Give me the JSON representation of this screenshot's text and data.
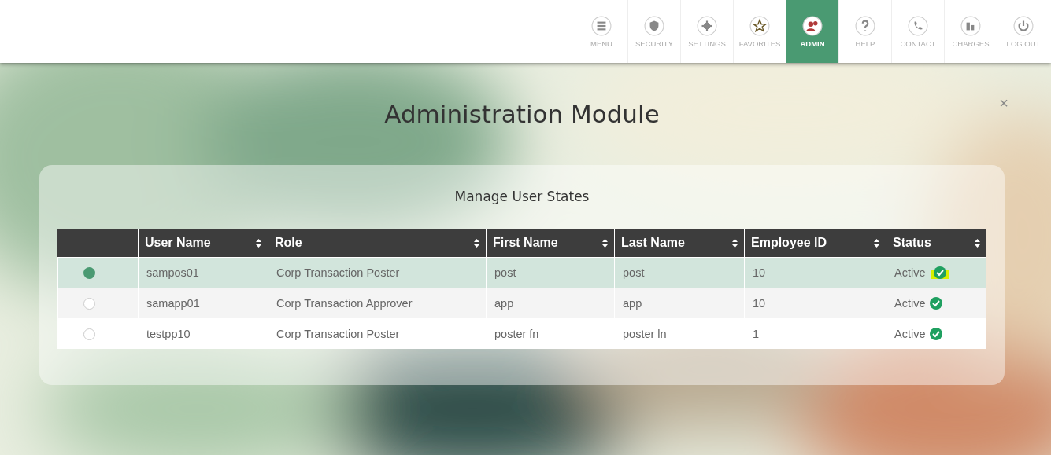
{
  "nav": {
    "items": [
      {
        "label": "MENU",
        "selected": false
      },
      {
        "label": "SECURITY",
        "selected": false
      },
      {
        "label": "SETTINGS",
        "selected": false
      },
      {
        "label": "FAVORITES",
        "selected": false
      },
      {
        "label": "ADMIN",
        "selected": true
      },
      {
        "label": "HELP",
        "selected": false
      },
      {
        "label": "CONTACT",
        "selected": false
      },
      {
        "label": "CHARGES",
        "selected": false
      },
      {
        "label": "LOG OUT",
        "selected": false
      }
    ]
  },
  "title": "Administration Module",
  "close": "×",
  "panel": {
    "title": "Manage User States",
    "table": {
      "columns": [
        "User Name",
        "Role",
        "First Name",
        "Last Name",
        "Employee ID",
        "Status"
      ],
      "rows": [
        {
          "selected": true,
          "cells": [
            "sampos01",
            "Corp Transaction Poster",
            "post",
            "post",
            "10",
            "Active"
          ],
          "highlighted": true
        },
        {
          "selected": false,
          "cells": [
            "samapp01",
            "Corp Transaction Approver",
            "app",
            "app",
            "10",
            "Active"
          ],
          "highlighted": false
        },
        {
          "selected": false,
          "cells": [
            "testpp10",
            "Corp Transaction Poster",
            "poster fn",
            "poster ln",
            "1",
            "Active"
          ],
          "highlighted": false
        }
      ]
    }
  }
}
